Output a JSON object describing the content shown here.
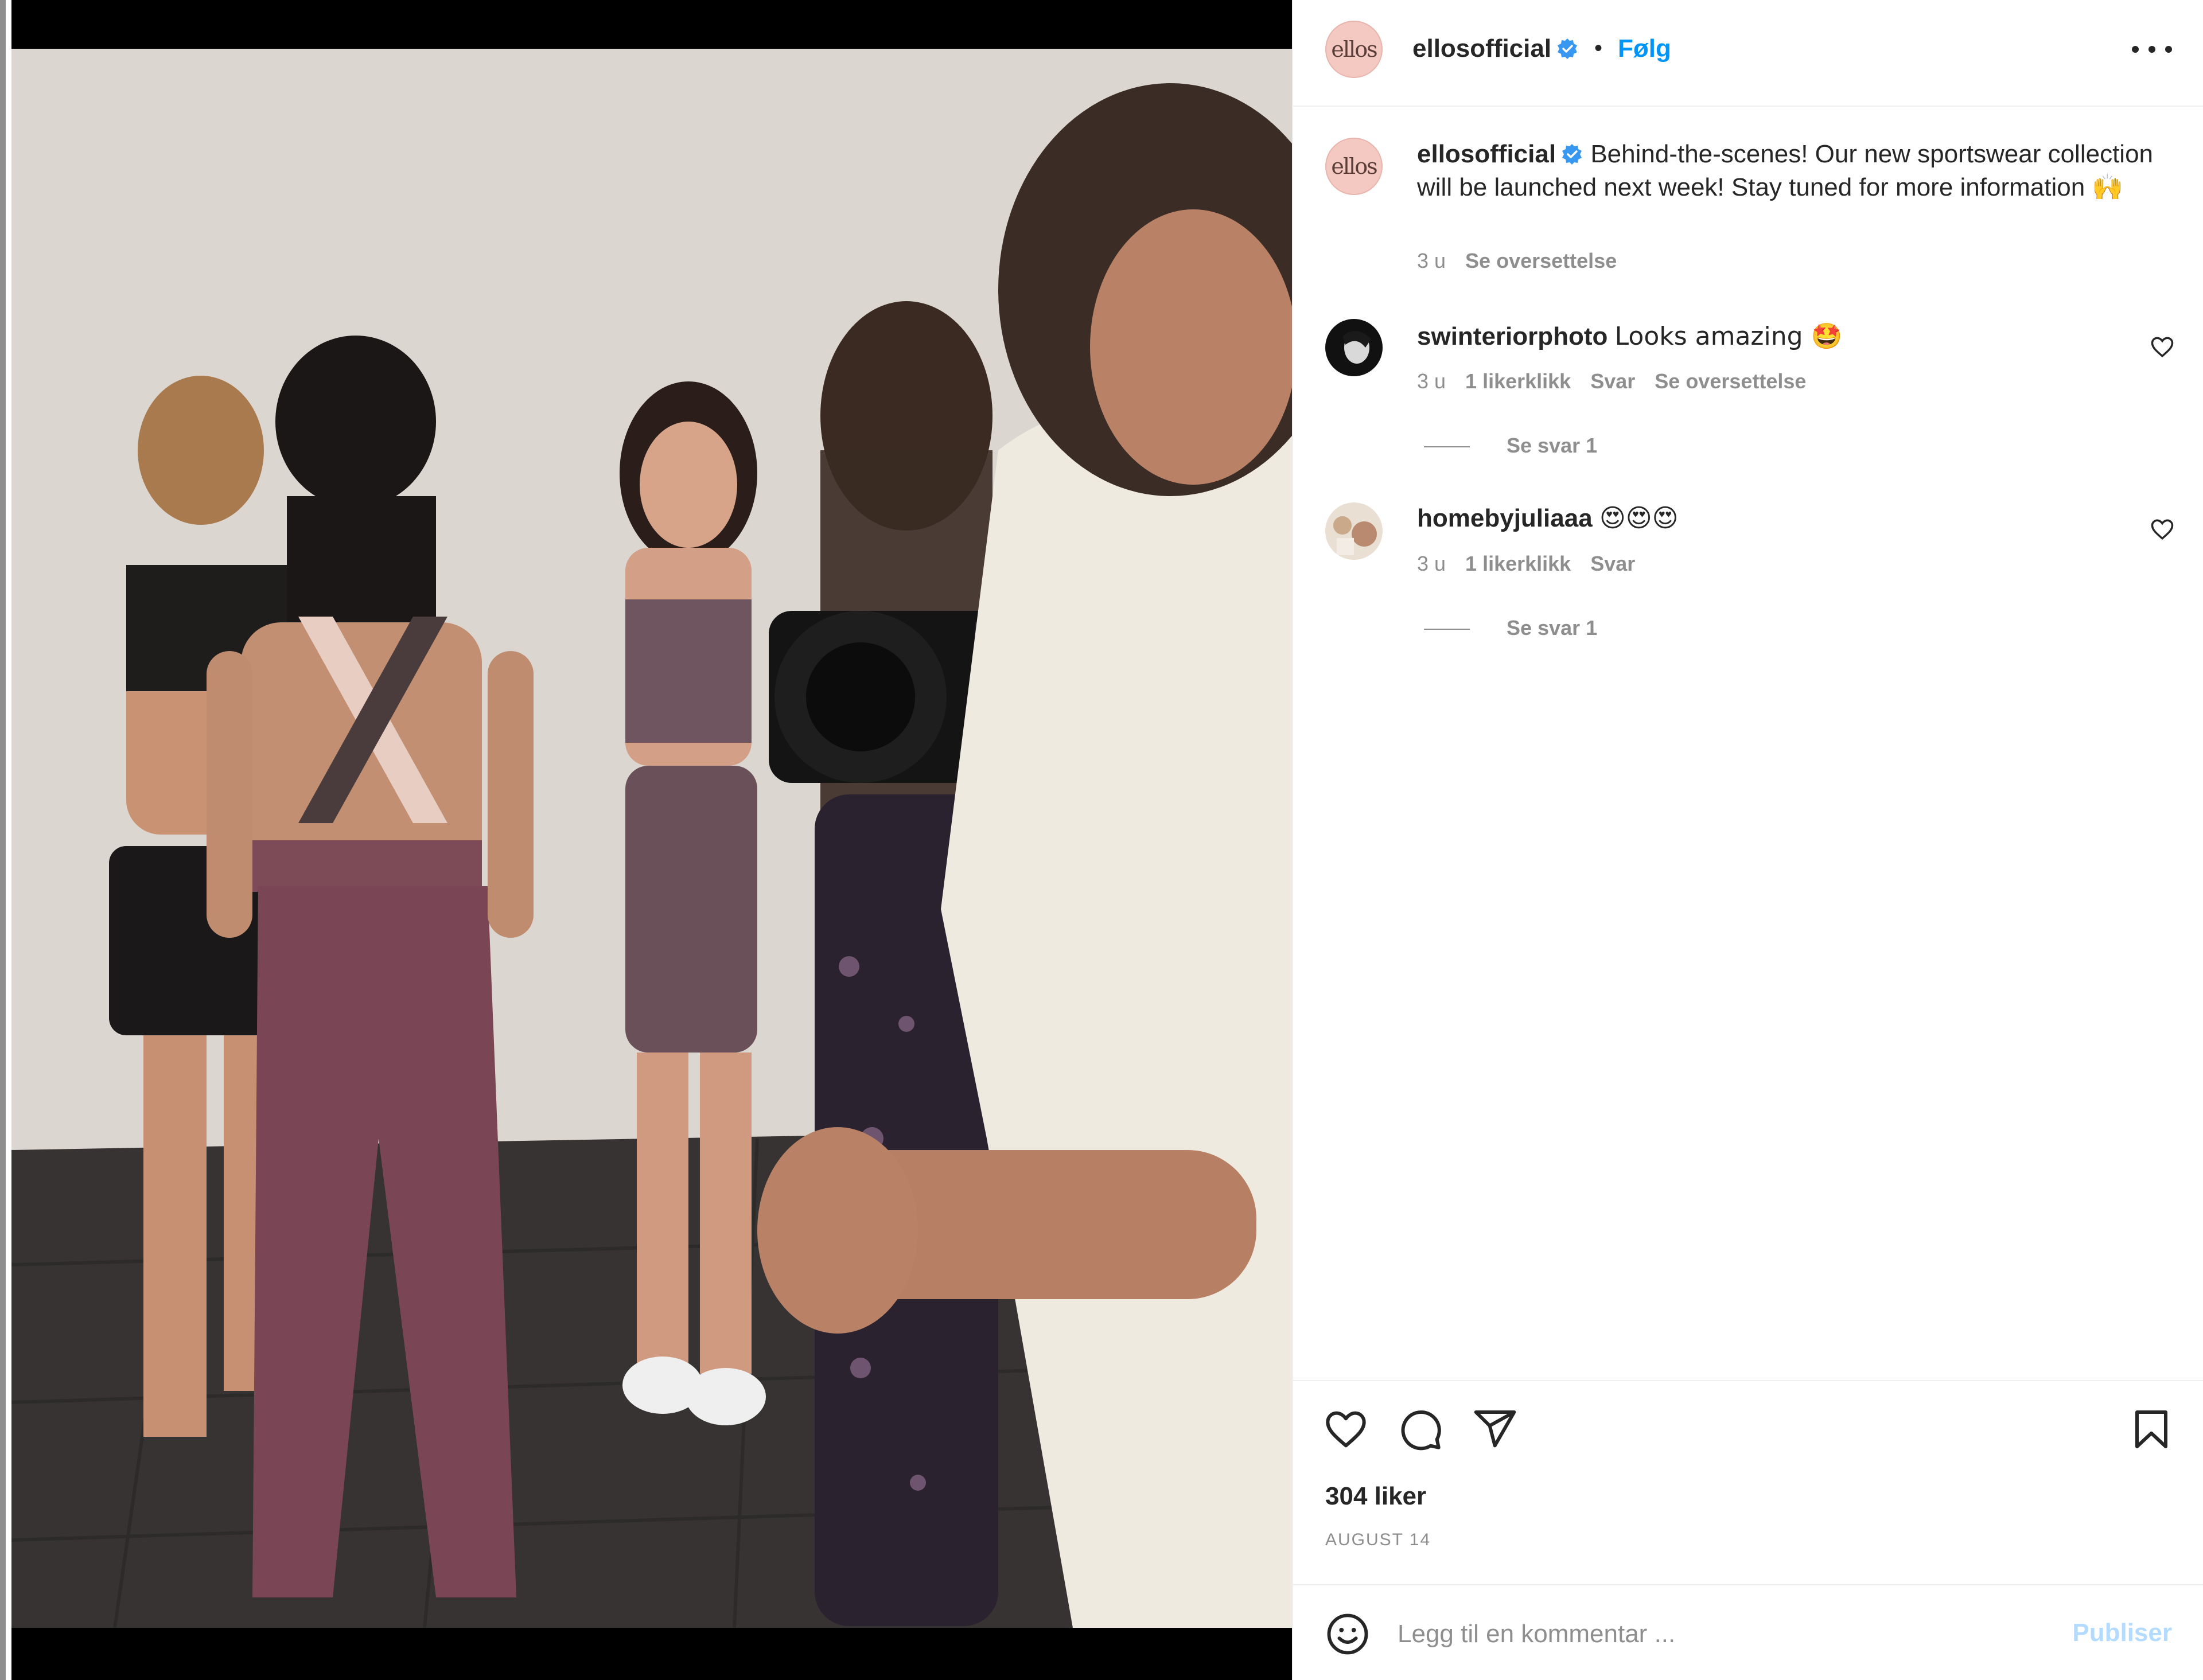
{
  "post": {
    "author": "ellosofficial",
    "avatar_text": "ellos",
    "follow_label": "Følg",
    "separator": "•"
  },
  "caption": {
    "username": "ellosofficial",
    "text": "Behind-the-scenes! Our new sportswear collection will be launched next week! Stay tuned for more information 🙌",
    "age": "3 u",
    "translate_label": "Se oversettelse"
  },
  "comments": [
    {
      "username": "swinteriorphoto",
      "text": "Looks amazing 🤩",
      "age": "3 u",
      "likes": "1 likerklikk",
      "reply_label": "Svar",
      "translate_label": "Se oversettelse",
      "view_replies": "Se svar 1"
    },
    {
      "username": "homebyjuliaaa",
      "text": "😍😍😍",
      "age": "3 u",
      "likes": "1 likerklikk",
      "reply_label": "Svar",
      "view_replies": "Se svar 1"
    }
  ],
  "stats": {
    "likes": "304 liker",
    "date": "AUGUST 14"
  },
  "composer": {
    "placeholder": "Legg til en kommentar ...",
    "publish_label": "Publiser"
  },
  "icons": {
    "verified": "verified-badge-icon",
    "more": "more-options-icon",
    "like": "heart-icon",
    "comment": "comment-bubble-icon",
    "share": "paper-plane-icon",
    "save": "bookmark-icon",
    "emoji": "smiley-icon"
  },
  "colors": {
    "accent": "#0095f6",
    "verified": "#3897f0",
    "publish_disabled": "#b3dbff",
    "muted": "#8e8e8e"
  }
}
